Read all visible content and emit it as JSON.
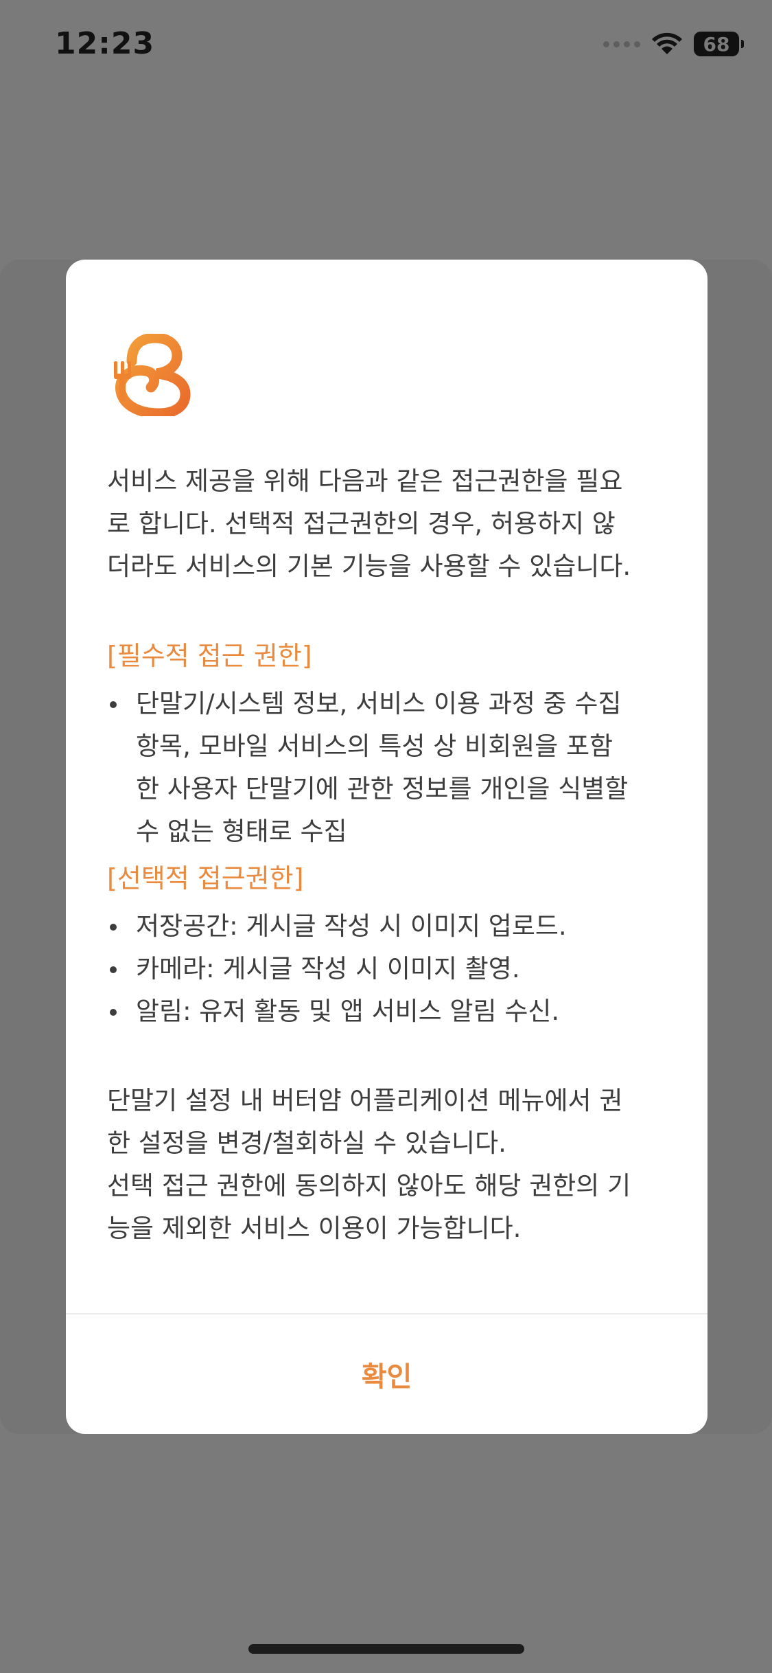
{
  "status_bar": {
    "time": "12:23",
    "battery_level": "68",
    "icons": [
      "signal-dots-icon",
      "wifi-icon",
      "battery-icon"
    ]
  },
  "dialog": {
    "logo": "butteryam-logo",
    "intro": "서비스 제공을 위해 다음과 같은 접근권한을 필요\n로 합니다. 선택적 접근권한의 경우, 허용하지 않\n더라도 서비스의 기본 기능을 사용할 수 있습니다.",
    "required_title": "[필수적 접근 권한]",
    "required_items": [
      "단말기/시스템 정보, 서비스 이용 과정 중 수집\n항목, 모바일 서비스의 특성 상 비회원을 포함\n한 사용자 단말기에 관한 정보를 개인을 식별할\n수 없는 형태로 수집"
    ],
    "optional_title": "[선택적 접근권한]",
    "optional_items": [
      "저장공간: 게시글 작성 시 이미지 업로드.",
      "카메라: 게시글 작성 시 이미지 촬영.",
      "알림: 유저 활동 및 앱 서비스 알림 수신."
    ],
    "note": "단말기 설정 내 버터얌 어플리케이션 메뉴에서 권\n한 설정을 변경/철회하실 수 있습니다.\n선택 접근 권한에 동의하지 않아도 해당 권한의 기\n능을 제외한 서비스 이용이 가능합니다.",
    "confirm_label": "확인"
  },
  "colors": {
    "accent": "#e98a3f",
    "overlay": "#7a7a7a",
    "text": "#3d3d3d"
  }
}
